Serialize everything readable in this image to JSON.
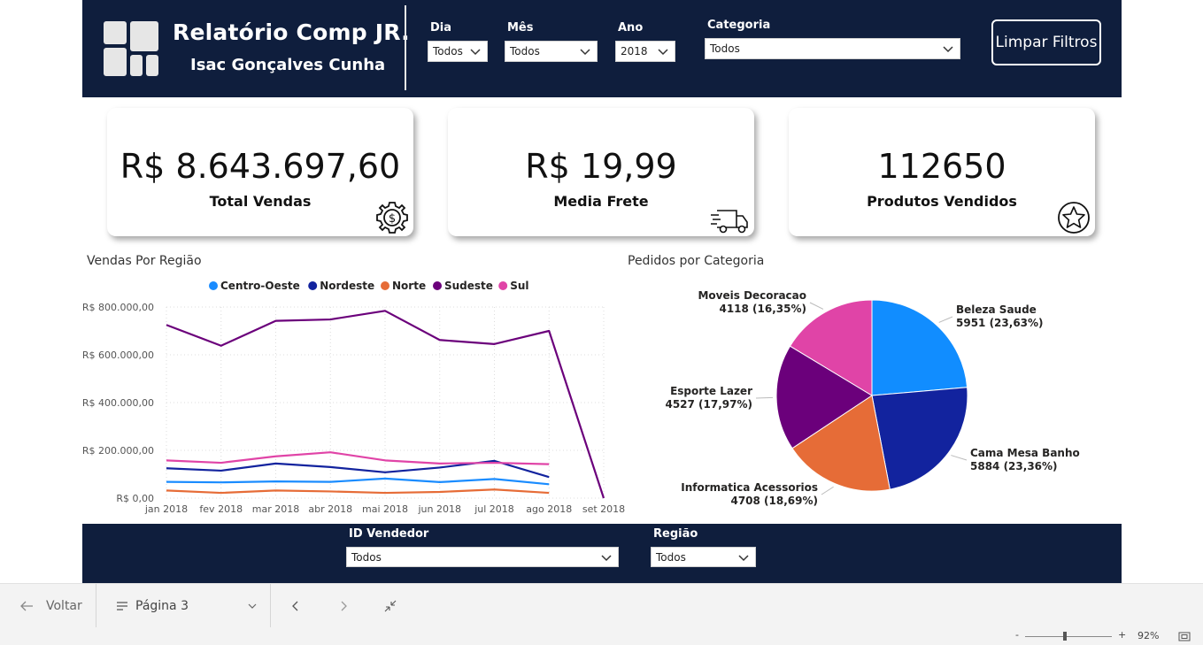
{
  "header": {
    "title": "Relatório Comp JR.",
    "subtitle": "Isac Gonçalves Cunha",
    "filters": {
      "dia": {
        "label": "Dia",
        "value": "Todos"
      },
      "mes": {
        "label": "Mês",
        "value": "Todos"
      },
      "ano": {
        "label": "Ano",
        "value": "2018"
      },
      "categoria": {
        "label": "Categoria",
        "value": "Todos"
      }
    },
    "clear_label": "Limpar Filtros"
  },
  "kpis": [
    {
      "value": "R$ 8.643.697,60",
      "label": "Total Vendas",
      "icon": "money-gear-icon"
    },
    {
      "value": "R$ 19,99",
      "label": "Media Frete",
      "icon": "delivery-truck-icon"
    },
    {
      "value": "112650",
      "label": "Produtos Vendidos",
      "icon": "star-icon"
    }
  ],
  "line_chart": {
    "title": "Vendas Por Região"
  },
  "pie_chart": {
    "title": "Pedidos por Categoria"
  },
  "bottom_filters": {
    "vendedor": {
      "label": "ID Vendedor",
      "value": "Todos"
    },
    "regiao": {
      "label": "Região",
      "value": "Todos"
    }
  },
  "footer": {
    "back_label": "Voltar",
    "page_label": "Página 3",
    "zoom": "92%"
  },
  "chart_data": [
    {
      "type": "line",
      "title": "Vendas Por Região",
      "x": [
        "jan 2018",
        "fev 2018",
        "mar 2018",
        "abr 2018",
        "mai 2018",
        "jun 2018",
        "jul 2018",
        "ago 2018",
        "set 2018"
      ],
      "y_ticks": [
        "R$ 0,00",
        "R$ 200.000,00",
        "R$ 400.000,00",
        "R$ 600.000,00",
        "R$ 800.000,00"
      ],
      "ylim": [
        0,
        800000
      ],
      "legend_position": "top",
      "grid": true,
      "series": [
        {
          "name": "Centro-Oeste",
          "color": "#1a8cff",
          "values": [
            68000,
            66000,
            70000,
            68000,
            82000,
            67000,
            80000,
            58000,
            null
          ]
        },
        {
          "name": "Nordeste",
          "color": "#12239e",
          "values": [
            125000,
            115000,
            145000,
            130000,
            108000,
            128000,
            156000,
            88000,
            null
          ]
        },
        {
          "name": "Norte",
          "color": "#e66c37",
          "values": [
            32000,
            22000,
            32000,
            28000,
            22000,
            26000,
            36000,
            22000,
            null
          ]
        },
        {
          "name": "Sudeste",
          "color": "#6b007b",
          "values": [
            725000,
            638000,
            742000,
            748000,
            784000,
            662000,
            645000,
            700000,
            0
          ]
        },
        {
          "name": "Sul",
          "color": "#e044a7",
          "values": [
            158000,
            148000,
            175000,
            192000,
            158000,
            145000,
            148000,
            142000,
            null
          ]
        }
      ]
    },
    {
      "type": "pie",
      "title": "Pedidos por Categoria",
      "slices": [
        {
          "name": "Beleza Saude",
          "value": 5951,
          "label": "5951 (23,63%)",
          "color": "#118dff"
        },
        {
          "name": "Cama Mesa Banho",
          "value": 5884,
          "label": "5884 (23,36%)",
          "color": "#12239e"
        },
        {
          "name": "Informatica Acessorios",
          "value": 4708,
          "label": "4708 (18,69%)",
          "color": "#e66c37"
        },
        {
          "name": "Esporte Lazer",
          "value": 4527,
          "label": "4527 (17,97%)",
          "color": "#6b007b"
        },
        {
          "name": "Moveis Decoracao",
          "value": 4118,
          "label": "4118 (16,35%)",
          "color": "#e044a7"
        }
      ]
    }
  ]
}
